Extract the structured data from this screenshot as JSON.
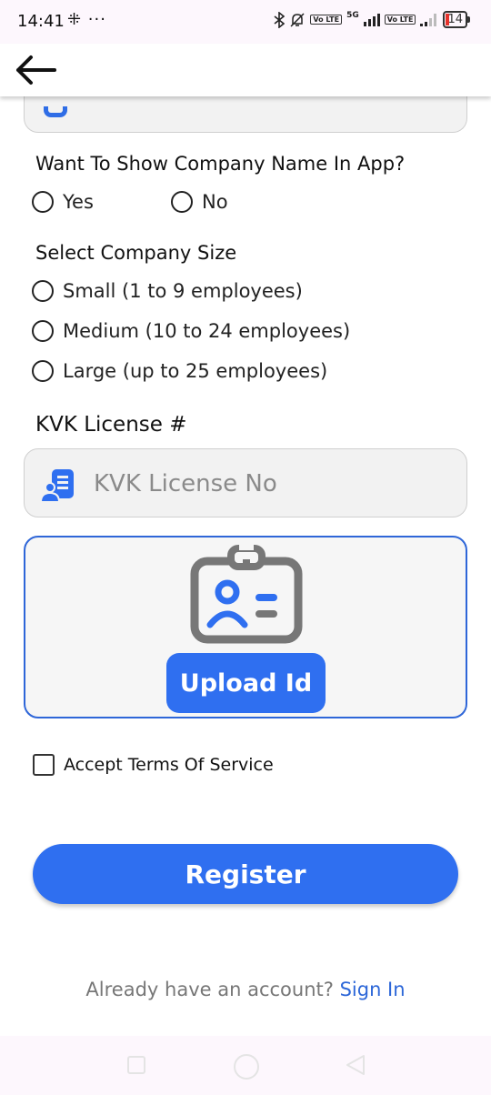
{
  "status_bar": {
    "time": "14:41",
    "extra": "⁜ ···",
    "network_1": "Vo LTE",
    "network_gen": "5G",
    "network_2": "Vo LTE",
    "battery": "14"
  },
  "header": {
    "back_icon": "arrow-left-icon"
  },
  "form": {
    "show_company_question": "Want To Show Company Name In App?",
    "show_company_options": [
      "Yes",
      "No"
    ],
    "company_size_label": "Select Company Size",
    "company_size_options": [
      "Small (1 to 9 employees)",
      "Medium (10 to 24 employees)",
      "Large (up to 25 employees)"
    ],
    "kvk_label": "KVK License #",
    "kvk_placeholder": "KVK License No",
    "kvk_value": "",
    "upload_button": "Upload Id",
    "terms_label": "Accept Terms Of Service",
    "terms_checked": false,
    "register_button": "Register",
    "signin_prompt": "Already have an account?",
    "signin_link": "Sign In"
  },
  "colors": {
    "primary": "#2f6ff0",
    "link": "#2d67d8",
    "icon_gray": "#777777"
  }
}
